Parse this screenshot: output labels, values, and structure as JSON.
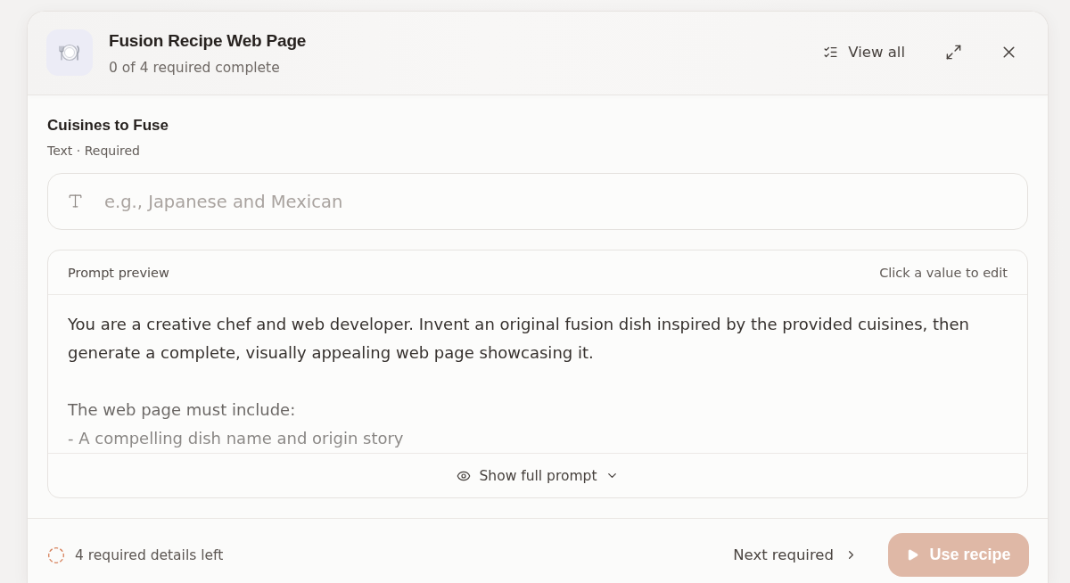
{
  "header": {
    "title": "Fusion Recipe Web Page",
    "subtitle": "0 of 4 required complete",
    "actions": [
      {
        "kind": "view_all",
        "label": "View all"
      },
      {
        "kind": "expand"
      },
      {
        "kind": "close"
      }
    ]
  },
  "field": {
    "label": "Cuisines to Fuse",
    "meta": "Text · Required",
    "placeholder": "e.g., Japanese and Mexican"
  },
  "prompt_preview": {
    "title": "Prompt preview",
    "hint": "Click a value to edit",
    "paragraphs": [
      {
        "lines": [
          "You are a creative chef and web developer. Invent an original fusion dish inspired by the provided cuisines, then generate a complete, visually appealing web page showcasing it."
        ]
      },
      {
        "lines": [
          "The web page must include:",
          "- A compelling dish name and origin story"
        ]
      }
    ],
    "expanded": false,
    "toggle_label": "Show full prompt"
  },
  "footer": {
    "status": "4 required details left",
    "next_label": "Next required",
    "primary": {
      "label": "Use recipe",
      "disabled": true
    }
  }
}
